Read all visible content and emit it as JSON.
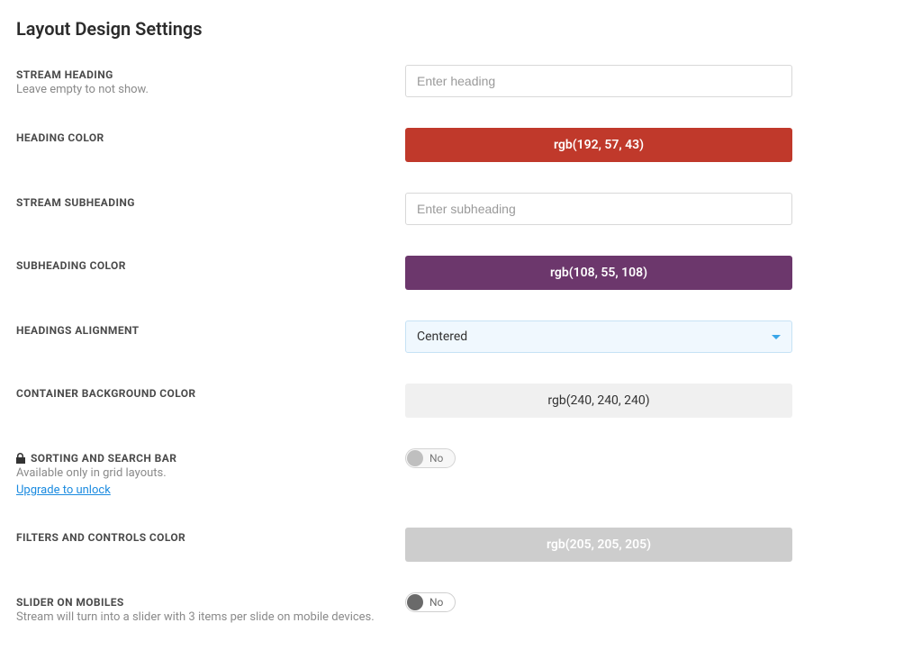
{
  "page": {
    "title": "Layout Design Settings"
  },
  "settings": {
    "stream_heading": {
      "label": "STREAM HEADING",
      "sublabel": "Leave empty to not show.",
      "placeholder": "Enter heading",
      "value": ""
    },
    "heading_color": {
      "label": "HEADING COLOR",
      "value_text": "rgb(192, 57, 43)",
      "hex": "#c0392b"
    },
    "stream_subheading": {
      "label": "STREAM SUBHEADING",
      "placeholder": "Enter subheading",
      "value": ""
    },
    "subheading_color": {
      "label": "SUBHEADING COLOR",
      "value_text": "rgb(108, 55, 108)",
      "hex": "#6c376c"
    },
    "headings_alignment": {
      "label": "HEADINGS ALIGNMENT",
      "selected": "Centered"
    },
    "container_bg_color": {
      "label": "CONTAINER BACKGROUND COLOR",
      "value_text": "rgb(240, 240, 240)",
      "hex": "#f0f0f0"
    },
    "sorting_search": {
      "label": "SORTING AND SEARCH BAR",
      "sublabel": "Available only in grid layouts.",
      "upgrade_text": "Upgrade to unlock",
      "toggle_label": "No",
      "value": false,
      "locked": true
    },
    "filters_controls_color": {
      "label": "FILTERS AND CONTROLS COLOR",
      "value_text": "rgb(205, 205, 205)",
      "hex": "#cdcdcd"
    },
    "slider_on_mobiles": {
      "label": "SLIDER ON MOBILES",
      "sublabel": "Stream will turn into a slider with 3 items per slide on mobile devices.",
      "toggle_label": "No",
      "value": false
    }
  }
}
